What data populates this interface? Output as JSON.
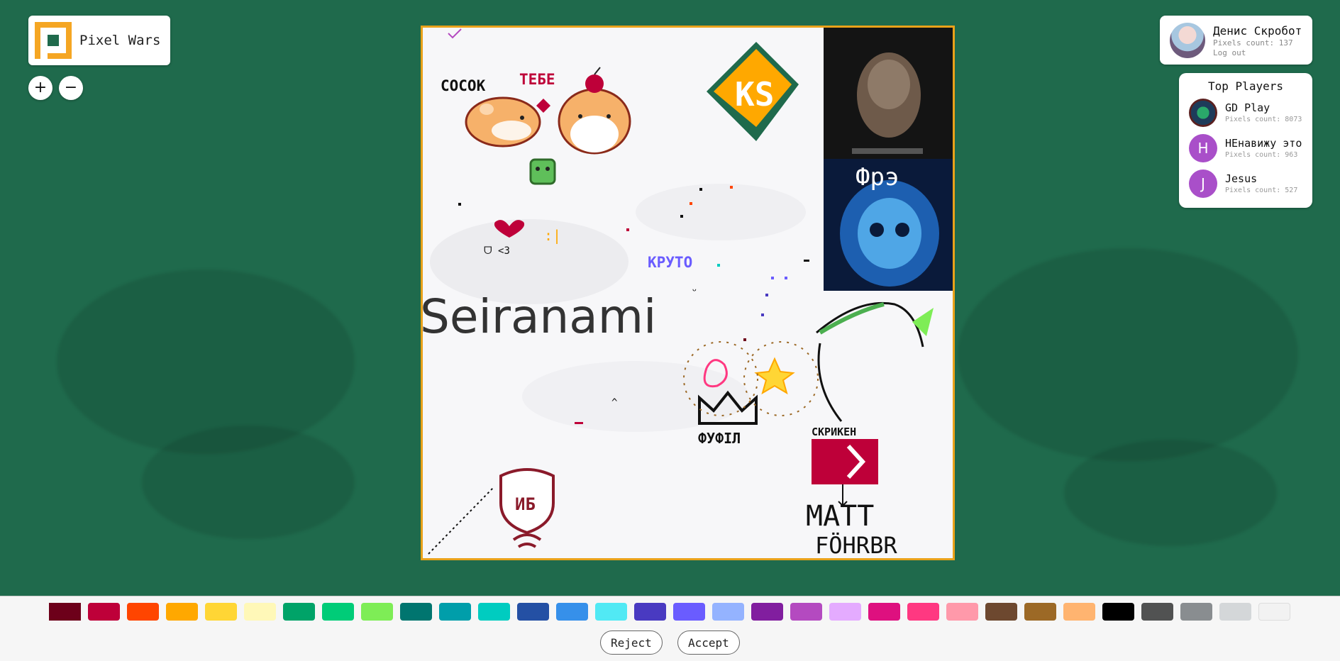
{
  "app": {
    "title": "Pixel Wars"
  },
  "zoom": {
    "in_label": "+",
    "out_label": "−"
  },
  "user": {
    "name": "Денис Скробот",
    "pixels": "Pixels count: 137",
    "logout": "Log out"
  },
  "top_players": {
    "title": "Top Players",
    "players": [
      {
        "name": "GD Play",
        "pixels": "Pixels count: 8073",
        "initial": "",
        "color": "#1e3b5a"
      },
      {
        "name": "НЕнавижу это",
        "pixels": "Pixels count: 963",
        "initial": "H",
        "color": "#a94fc9"
      },
      {
        "name": "Jesus",
        "pixels": "Pixels count: 527",
        "initial": "J",
        "color": "#a94fc9"
      }
    ]
  },
  "canvas_text": {
    "cocok": "COCOK",
    "tebe": "ТЕБЕ",
    "kpyto": "КРУТО",
    "seiranami": "Seiranami",
    "fufil": "ФУФІЛ",
    "skryken": "СКРИКЕН",
    "matt": "MATT",
    "fohrbr": "FÖHRBR",
    "fre": "Фрэ",
    "ib": "ИБ"
  },
  "palette": [
    "#6d001a",
    "#be0039",
    "#ff4500",
    "#ffa800",
    "#ffd635",
    "#fff8b8",
    "#00a368",
    "#00cc78",
    "#7eed56",
    "#00756f",
    "#009eaa",
    "#00ccc0",
    "#2450a4",
    "#3690ea",
    "#51e9f4",
    "#493ac1",
    "#6a5cff",
    "#94b3ff",
    "#811e9f",
    "#b44ac0",
    "#e4abff",
    "#de107f",
    "#ff3881",
    "#ff99aa",
    "#6d482f",
    "#9c6926",
    "#ffb470",
    "#000000",
    "#515252",
    "#898d90",
    "#d4d7d9",
    "#f2f2f2"
  ],
  "selected_color": "#6d001a",
  "actions": {
    "reject": "Reject",
    "accept": "Accept"
  }
}
